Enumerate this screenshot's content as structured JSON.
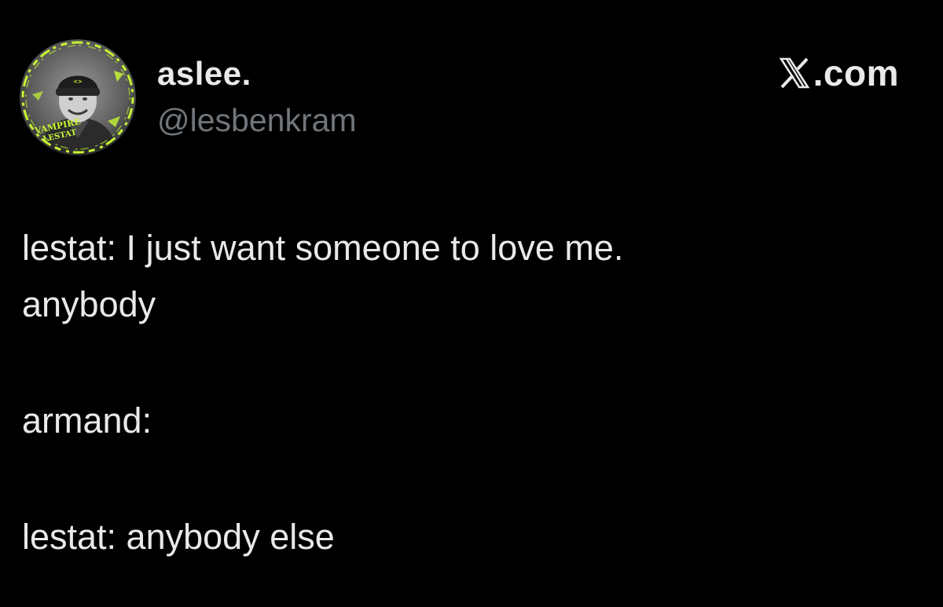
{
  "author": {
    "display_name": "aslee.",
    "handle": "@lesbenkram",
    "avatar_badge_line1": "VAMPIRE",
    "avatar_badge_line2": "LESTAT"
  },
  "brand": {
    "text": ".com",
    "logo_icon": "x-logo-icon"
  },
  "tweet": {
    "lines": [
      "lestat: I just want someone to love me.",
      "anybody",
      "",
      "armand:",
      "",
      "lestat: anybody else"
    ]
  },
  "colors": {
    "background": "#000000",
    "text_primary": "#e7e9ea",
    "text_secondary": "#71767b",
    "avatar_accent": "#c6f432"
  }
}
